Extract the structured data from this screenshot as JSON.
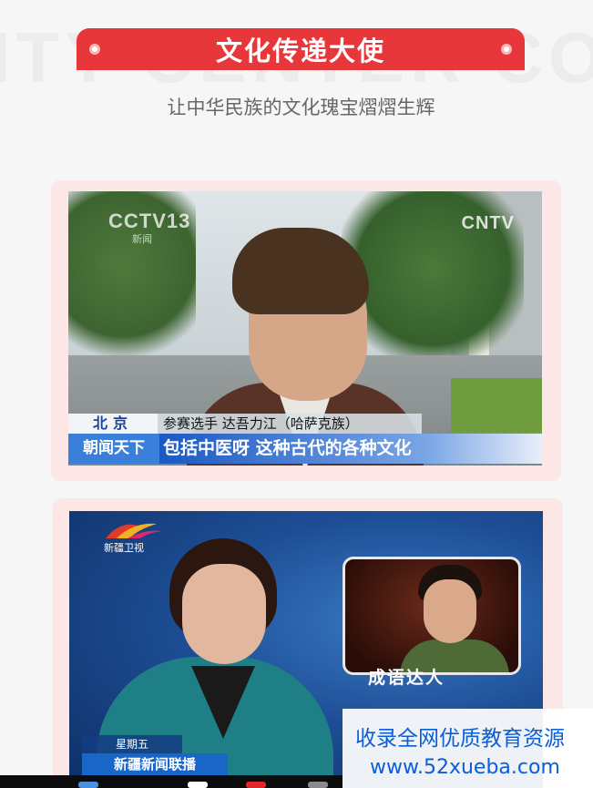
{
  "watermark": {
    "text": "ITY CENTER COM"
  },
  "header": {
    "title": "文化传递大使",
    "subtitle": "让中华民族的文化瑰宝熠熠生辉"
  },
  "video1": {
    "channel_logo": "CCTV13",
    "channel_sub": "新闻",
    "corner_logo": "CNTV",
    "location": "北京",
    "name_caption": "参赛选手 达吾力江（哈萨克族）",
    "program": "朝闻天下",
    "quote": "包括中医呀 这种古代的各种文化"
  },
  "video2": {
    "channel_logo_text": "新疆卫视",
    "inset_caption": "成语达人",
    "day": "星期五",
    "program": "新疆新闻联播"
  },
  "ad": {
    "line1": "收录全网优质教育资源",
    "line2": "www.52xueba.com"
  },
  "colors": {
    "banner": "#e8373a",
    "card_bg": "#fde6e6",
    "ad_text": "#0b5ed7"
  }
}
